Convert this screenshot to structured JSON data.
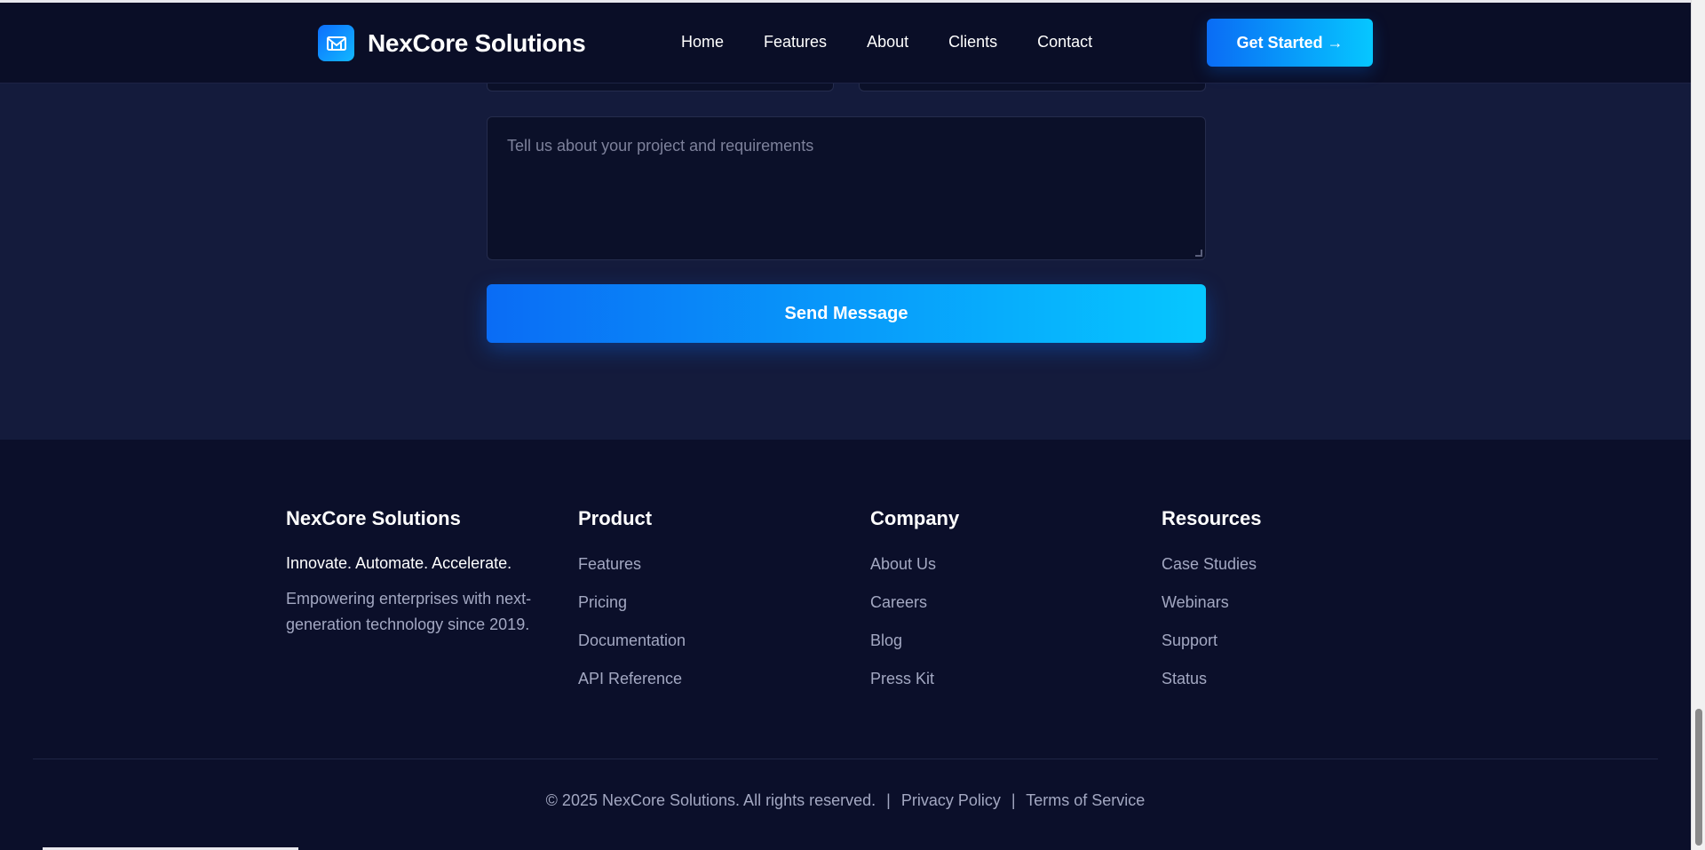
{
  "header": {
    "brand": "NexCore Solutions",
    "logo_icon": "m-logo-icon",
    "nav": [
      "Home",
      "Features",
      "About",
      "Clients",
      "Contact"
    ],
    "cta_label": "Get Started →"
  },
  "contact": {
    "message_placeholder": "Tell us about your project and requirements",
    "send_label": "Send Message"
  },
  "footer": {
    "brand": {
      "title": "NexCore Solutions",
      "tagline": "Innovate. Automate. Accelerate.",
      "description": "Empowering enterprises with next-generation technology since 2019."
    },
    "product": {
      "title": "Product",
      "links": [
        "Features",
        "Pricing",
        "Documentation",
        "API Reference"
      ]
    },
    "company": {
      "title": "Company",
      "links": [
        "About Us",
        "Careers",
        "Blog",
        "Press Kit"
      ]
    },
    "resources": {
      "title": "Resources",
      "links": [
        "Case Studies",
        "Webinars",
        "Support",
        "Status"
      ]
    },
    "copyright": "© 2025 NexCore Solutions. All rights reserved.",
    "separator": "|",
    "privacy_label": "Privacy Policy",
    "terms_label": "Terms of Service"
  },
  "colors": {
    "background": "#0b0f2a",
    "section_background": "#141b3c",
    "accent_start": "#0a6cf5",
    "accent_end": "#06c7ff",
    "muted_text": "#a3a8c2"
  }
}
